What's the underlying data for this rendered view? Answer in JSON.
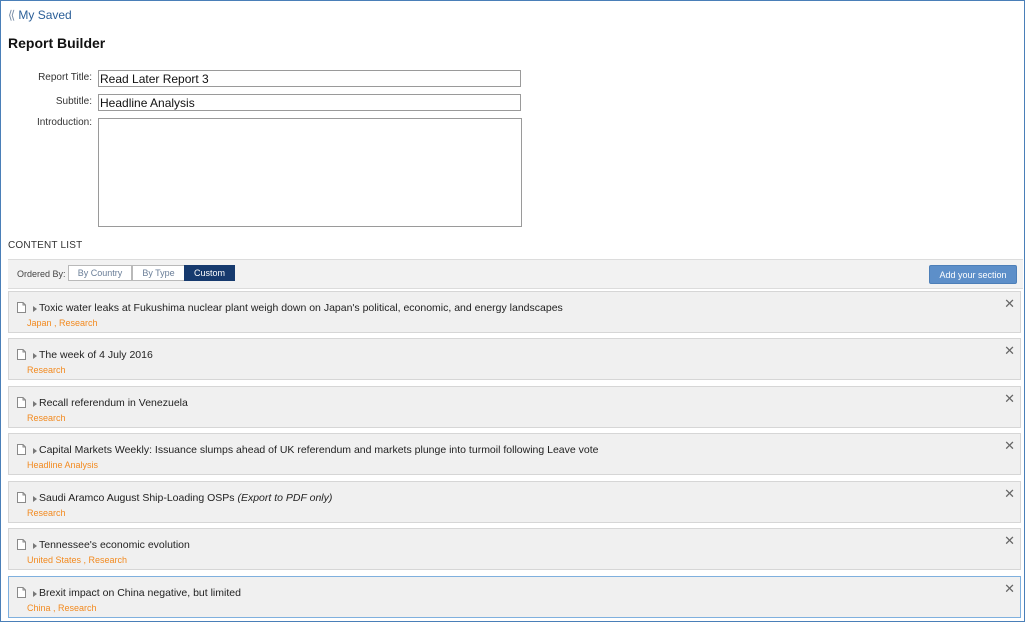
{
  "nav": {
    "back_label": "My Saved"
  },
  "page": {
    "title": "Report Builder"
  },
  "form": {
    "report_title_label": "Report Title:",
    "report_title_value": "Read Later Report 3",
    "subtitle_label": "Subtitle:",
    "subtitle_value": "Headline Analysis",
    "introduction_label": "Introduction:",
    "introduction_value": ""
  },
  "content_list": {
    "heading": "CONTENT LIST",
    "ordered_by_label": "Ordered By:",
    "order_options": [
      "By Country",
      "By Type",
      "Custom"
    ],
    "selected_order": "Custom",
    "add_section_label": "Add your section",
    "items": [
      {
        "title": "Toxic water leaks at Fukushima nuclear plant weigh down on Japan's political, economic, and energy landscapes",
        "note": "",
        "tags": "Japan , Research"
      },
      {
        "title": "The week of 4 July 2016",
        "note": "",
        "tags": "Research"
      },
      {
        "title": "Recall referendum in Venezuela",
        "note": "",
        "tags": "Research"
      },
      {
        "title": "Capital Markets Weekly: Issuance slumps ahead of UK referendum and markets plunge into turmoil following Leave vote",
        "note": "",
        "tags": "Headline Analysis"
      },
      {
        "title": "Saudi Aramco August Ship-Loading OSPs",
        "note": "(Export to PDF only)",
        "tags": "Research"
      },
      {
        "title": "Tennessee's economic evolution",
        "note": "",
        "tags": "United States , Research"
      },
      {
        "title": "Brexit impact on China negative, but limited",
        "note": "",
        "tags": "China , Research"
      }
    ]
  },
  "icons": {
    "back": "double-chevron-left-icon",
    "document": "document-icon",
    "caret": "caret-right-icon",
    "close": "close-icon"
  },
  "colors": {
    "link": "#2b5f98",
    "tag": "#f28a1f",
    "active_segment": "#163a6e",
    "add_button": "#5d8fc9",
    "frame": "#4a7fb8"
  }
}
